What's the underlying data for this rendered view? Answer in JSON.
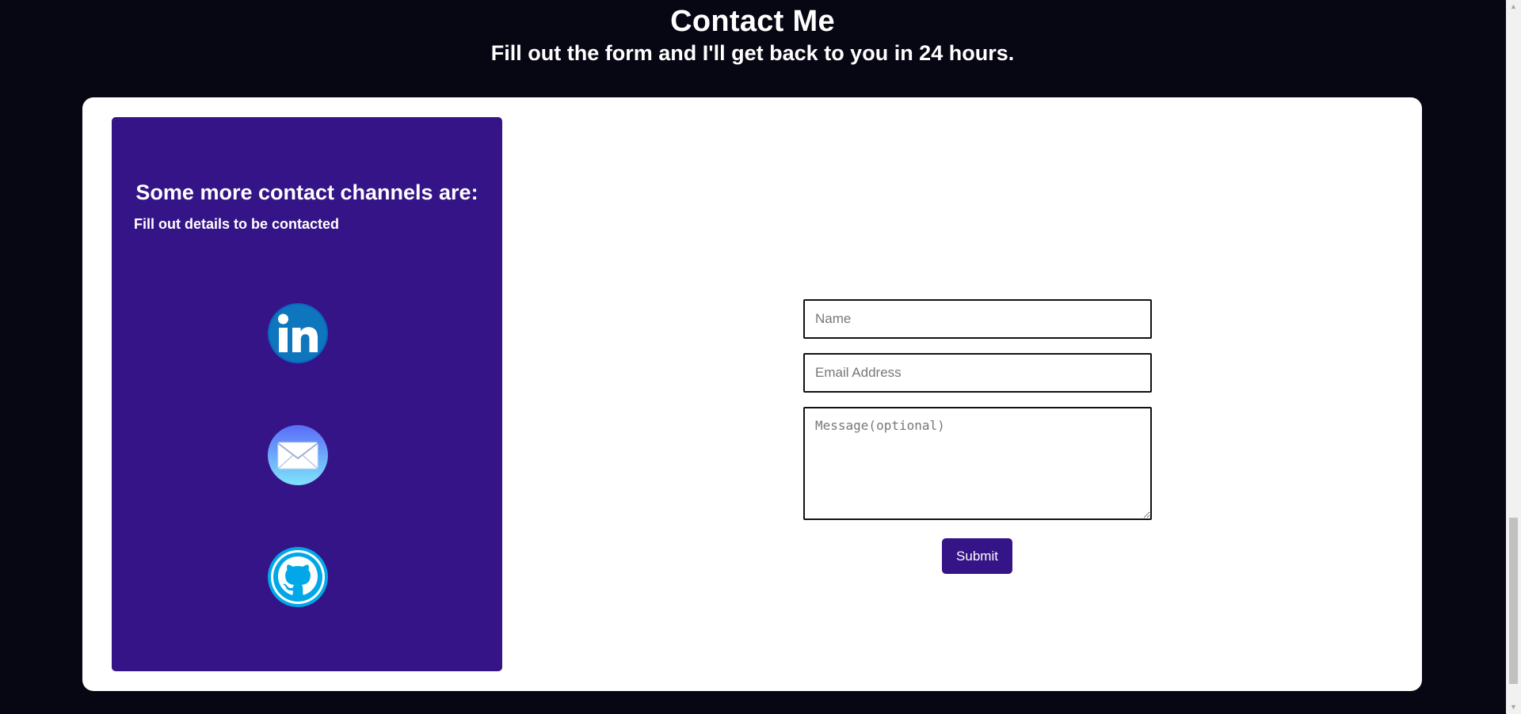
{
  "header": {
    "title": "Contact Me",
    "subtitle": "Fill out the form and I'll get back to you in 24 hours."
  },
  "panel": {
    "title": "Some more contact channels are:",
    "subtitle": "Fill out details to be contacted",
    "channels": [
      {
        "icon": "linkedin-icon",
        "color": "#0077b5"
      },
      {
        "icon": "mail-icon",
        "color": "#5aa9f8"
      },
      {
        "icon": "github-icon",
        "color": "#00a8e8"
      }
    ]
  },
  "form": {
    "name_placeholder": "Name",
    "email_placeholder": "Email Address",
    "message_placeholder": "Message(optional)",
    "submit_label": "Submit"
  },
  "colors": {
    "background": "#070613",
    "accent": "#351487",
    "card": "#ffffff"
  }
}
